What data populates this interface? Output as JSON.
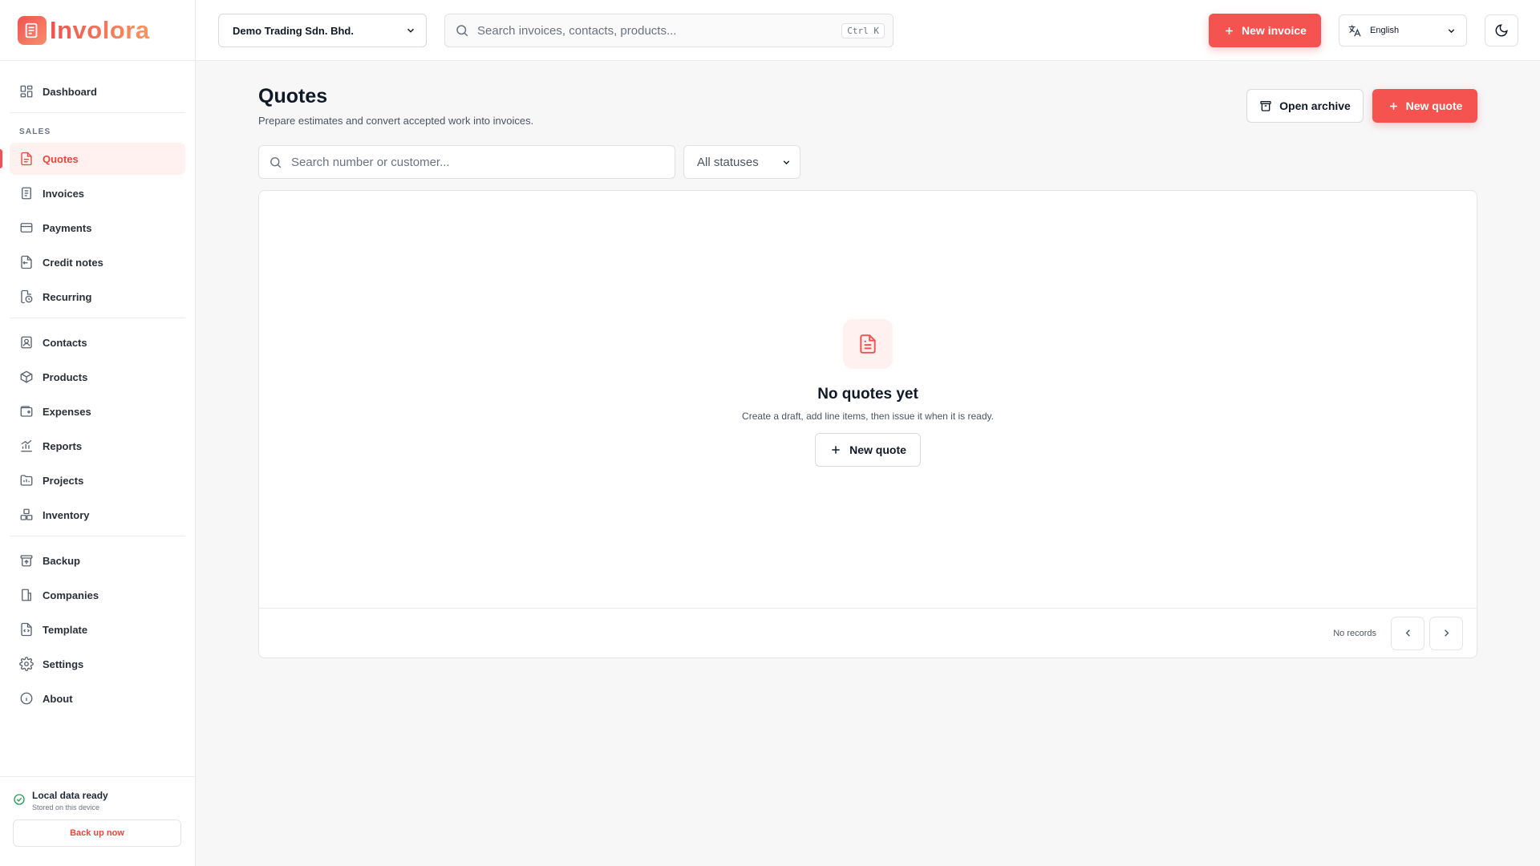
{
  "app": {
    "name": "Involora"
  },
  "sidebar": {
    "top": [
      {
        "label": "Dashboard",
        "icon": "dashboard-icon"
      }
    ],
    "section_label": "SALES",
    "sales": [
      {
        "label": "Quotes",
        "icon": "quote-icon",
        "active": true
      },
      {
        "label": "Invoices",
        "icon": "invoice-icon"
      },
      {
        "label": "Payments",
        "icon": "card-icon"
      },
      {
        "label": "Credit notes",
        "icon": "credit-note-icon"
      },
      {
        "label": "Recurring",
        "icon": "recurring-icon"
      }
    ],
    "manage": [
      {
        "label": "Contacts",
        "icon": "contact-icon"
      },
      {
        "label": "Products",
        "icon": "package-icon"
      },
      {
        "label": "Expenses",
        "icon": "wallet-icon"
      },
      {
        "label": "Reports",
        "icon": "chart-icon"
      },
      {
        "label": "Projects",
        "icon": "folder-icon"
      },
      {
        "label": "Inventory",
        "icon": "boxes-icon"
      }
    ],
    "system": [
      {
        "label": "Backup",
        "icon": "archive-icon"
      },
      {
        "label": "Companies",
        "icon": "building-icon"
      },
      {
        "label": "Template",
        "icon": "template-icon"
      },
      {
        "label": "Settings",
        "icon": "gear-icon"
      },
      {
        "label": "About",
        "icon": "info-icon"
      }
    ],
    "footer": {
      "status_title": "Local data ready",
      "status_sub": "Stored on this device",
      "backup_label": "Back up now"
    }
  },
  "topbar": {
    "company": "Demo Trading Sdn. Bhd.",
    "search_placeholder": "Search invoices, contacts, products...",
    "shortcut": "Ctrl K",
    "new_invoice_label": "New invoice",
    "language": "English"
  },
  "page": {
    "title": "Quotes",
    "subtitle": "Prepare estimates and convert accepted work into invoices.",
    "archive_label": "Open archive",
    "new_quote_label": "New quote",
    "filter_search_placeholder": "Search number or customer...",
    "status_filter": "All statuses"
  },
  "empty_state": {
    "title": "No quotes yet",
    "subtitle": "Create a draft, add line items, then issue it when it is ready.",
    "button_label": "New quote"
  },
  "pagination": {
    "records_text": "No records"
  },
  "colors": {
    "accent": "#f4534f",
    "accent_soft": "#fff1ef",
    "success": "#1f9d55"
  }
}
